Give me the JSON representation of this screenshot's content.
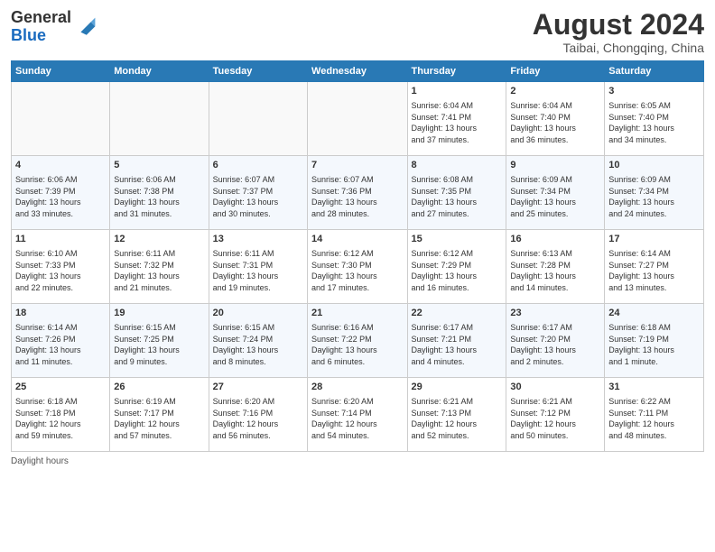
{
  "header": {
    "logo_general": "General",
    "logo_blue": "Blue",
    "month_year": "August 2024",
    "location": "Taibai, Chongqing, China"
  },
  "weekdays": [
    "Sunday",
    "Monday",
    "Tuesday",
    "Wednesday",
    "Thursday",
    "Friday",
    "Saturday"
  ],
  "weeks": [
    [
      {
        "day": "",
        "info": ""
      },
      {
        "day": "",
        "info": ""
      },
      {
        "day": "",
        "info": ""
      },
      {
        "day": "",
        "info": ""
      },
      {
        "day": "1",
        "info": "Sunrise: 6:04 AM\nSunset: 7:41 PM\nDaylight: 13 hours\nand 37 minutes."
      },
      {
        "day": "2",
        "info": "Sunrise: 6:04 AM\nSunset: 7:40 PM\nDaylight: 13 hours\nand 36 minutes."
      },
      {
        "day": "3",
        "info": "Sunrise: 6:05 AM\nSunset: 7:40 PM\nDaylight: 13 hours\nand 34 minutes."
      }
    ],
    [
      {
        "day": "4",
        "info": "Sunrise: 6:06 AM\nSunset: 7:39 PM\nDaylight: 13 hours\nand 33 minutes."
      },
      {
        "day": "5",
        "info": "Sunrise: 6:06 AM\nSunset: 7:38 PM\nDaylight: 13 hours\nand 31 minutes."
      },
      {
        "day": "6",
        "info": "Sunrise: 6:07 AM\nSunset: 7:37 PM\nDaylight: 13 hours\nand 30 minutes."
      },
      {
        "day": "7",
        "info": "Sunrise: 6:07 AM\nSunset: 7:36 PM\nDaylight: 13 hours\nand 28 minutes."
      },
      {
        "day": "8",
        "info": "Sunrise: 6:08 AM\nSunset: 7:35 PM\nDaylight: 13 hours\nand 27 minutes."
      },
      {
        "day": "9",
        "info": "Sunrise: 6:09 AM\nSunset: 7:34 PM\nDaylight: 13 hours\nand 25 minutes."
      },
      {
        "day": "10",
        "info": "Sunrise: 6:09 AM\nSunset: 7:34 PM\nDaylight: 13 hours\nand 24 minutes."
      }
    ],
    [
      {
        "day": "11",
        "info": "Sunrise: 6:10 AM\nSunset: 7:33 PM\nDaylight: 13 hours\nand 22 minutes."
      },
      {
        "day": "12",
        "info": "Sunrise: 6:11 AM\nSunset: 7:32 PM\nDaylight: 13 hours\nand 21 minutes."
      },
      {
        "day": "13",
        "info": "Sunrise: 6:11 AM\nSunset: 7:31 PM\nDaylight: 13 hours\nand 19 minutes."
      },
      {
        "day": "14",
        "info": "Sunrise: 6:12 AM\nSunset: 7:30 PM\nDaylight: 13 hours\nand 17 minutes."
      },
      {
        "day": "15",
        "info": "Sunrise: 6:12 AM\nSunset: 7:29 PM\nDaylight: 13 hours\nand 16 minutes."
      },
      {
        "day": "16",
        "info": "Sunrise: 6:13 AM\nSunset: 7:28 PM\nDaylight: 13 hours\nand 14 minutes."
      },
      {
        "day": "17",
        "info": "Sunrise: 6:14 AM\nSunset: 7:27 PM\nDaylight: 13 hours\nand 13 minutes."
      }
    ],
    [
      {
        "day": "18",
        "info": "Sunrise: 6:14 AM\nSunset: 7:26 PM\nDaylight: 13 hours\nand 11 minutes."
      },
      {
        "day": "19",
        "info": "Sunrise: 6:15 AM\nSunset: 7:25 PM\nDaylight: 13 hours\nand 9 minutes."
      },
      {
        "day": "20",
        "info": "Sunrise: 6:15 AM\nSunset: 7:24 PM\nDaylight: 13 hours\nand 8 minutes."
      },
      {
        "day": "21",
        "info": "Sunrise: 6:16 AM\nSunset: 7:22 PM\nDaylight: 13 hours\nand 6 minutes."
      },
      {
        "day": "22",
        "info": "Sunrise: 6:17 AM\nSunset: 7:21 PM\nDaylight: 13 hours\nand 4 minutes."
      },
      {
        "day": "23",
        "info": "Sunrise: 6:17 AM\nSunset: 7:20 PM\nDaylight: 13 hours\nand 2 minutes."
      },
      {
        "day": "24",
        "info": "Sunrise: 6:18 AM\nSunset: 7:19 PM\nDaylight: 13 hours\nand 1 minute."
      }
    ],
    [
      {
        "day": "25",
        "info": "Sunrise: 6:18 AM\nSunset: 7:18 PM\nDaylight: 12 hours\nand 59 minutes."
      },
      {
        "day": "26",
        "info": "Sunrise: 6:19 AM\nSunset: 7:17 PM\nDaylight: 12 hours\nand 57 minutes."
      },
      {
        "day": "27",
        "info": "Sunrise: 6:20 AM\nSunset: 7:16 PM\nDaylight: 12 hours\nand 56 minutes."
      },
      {
        "day": "28",
        "info": "Sunrise: 6:20 AM\nSunset: 7:14 PM\nDaylight: 12 hours\nand 54 minutes."
      },
      {
        "day": "29",
        "info": "Sunrise: 6:21 AM\nSunset: 7:13 PM\nDaylight: 12 hours\nand 52 minutes."
      },
      {
        "day": "30",
        "info": "Sunrise: 6:21 AM\nSunset: 7:12 PM\nDaylight: 12 hours\nand 50 minutes."
      },
      {
        "day": "31",
        "info": "Sunrise: 6:22 AM\nSunset: 7:11 PM\nDaylight: 12 hours\nand 48 minutes."
      }
    ]
  ],
  "footer": {
    "note": "Daylight hours"
  }
}
